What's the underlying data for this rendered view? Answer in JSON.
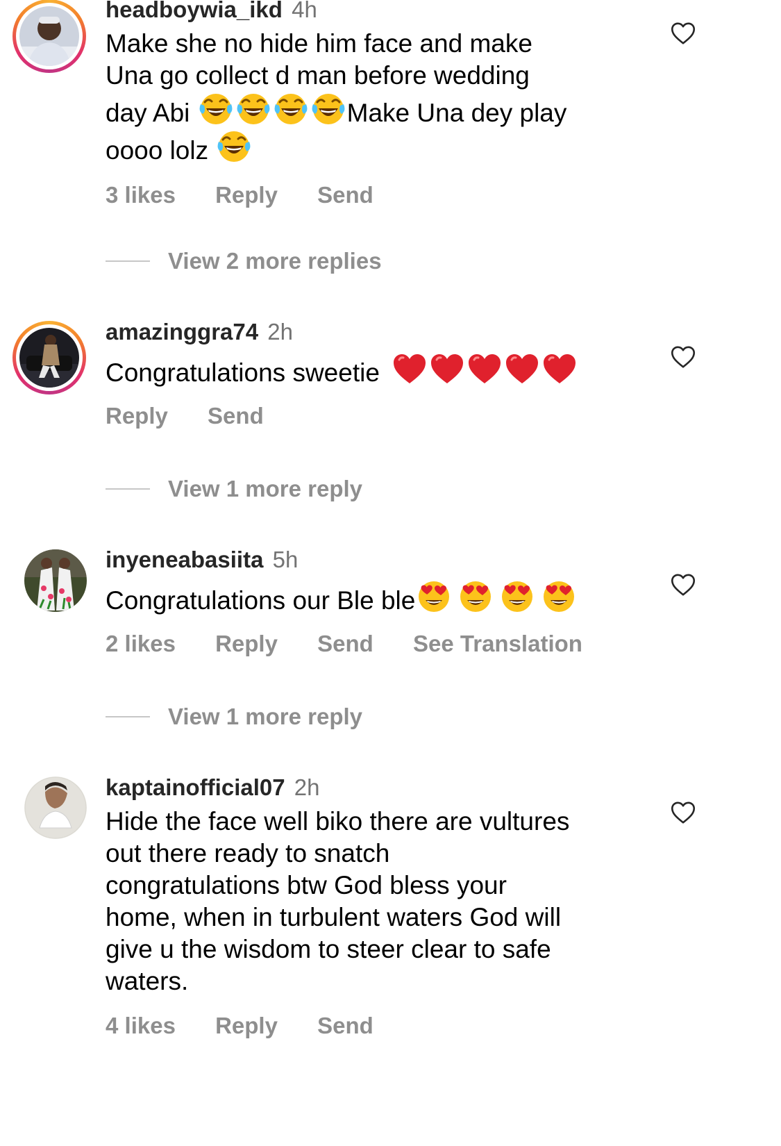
{
  "comments": [
    {
      "username": "headboywia_ikd",
      "time": "4h",
      "text_lines": [
        "Make she no hide him face and make",
        "Una go collect d man before wedding",
        "day Abi",
        "Make Una dey play",
        "oooo lolz"
      ],
      "emoji_icons": [
        "tears-of-joy-emoji-icon"
      ],
      "likes": "3 likes",
      "reply": "Reply",
      "send": "Send",
      "view_more": "View 2 more replies"
    },
    {
      "username": "amazinggra74",
      "time": "2h",
      "text": "Congratulations sweetie",
      "emoji_icons": [
        "red-heart-emoji-icon"
      ],
      "reply": "Reply",
      "send": "Send",
      "view_more": "View 1 more reply"
    },
    {
      "username": "inyeneabasiita",
      "time": "5h",
      "text": "Congratulations our Ble ble",
      "emoji_icons": [
        "heart-eyes-emoji-icon"
      ],
      "likes": "2 likes",
      "reply": "Reply",
      "send": "Send",
      "translation": "See Translation",
      "view_more": "View 1 more reply"
    },
    {
      "username": "kaptainofficial07",
      "time": "2h",
      "text_lines": [
        "Hide the face well biko there are vultures",
        "out there ready to snatch",
        "congratulations btw God bless your",
        "home, when in turbulent waters God will",
        "give u the wisdom to steer clear to safe",
        "waters."
      ],
      "likes": "4 likes",
      "reply": "Reply",
      "send": "Send"
    }
  ],
  "colors": {
    "username": "#262626",
    "secondary": "#8e8e8e",
    "story_ring": [
      "#f9b234",
      "#e1306c",
      "#c13584"
    ]
  },
  "icons": [
    "heart-outline-icon",
    "avatar"
  ]
}
